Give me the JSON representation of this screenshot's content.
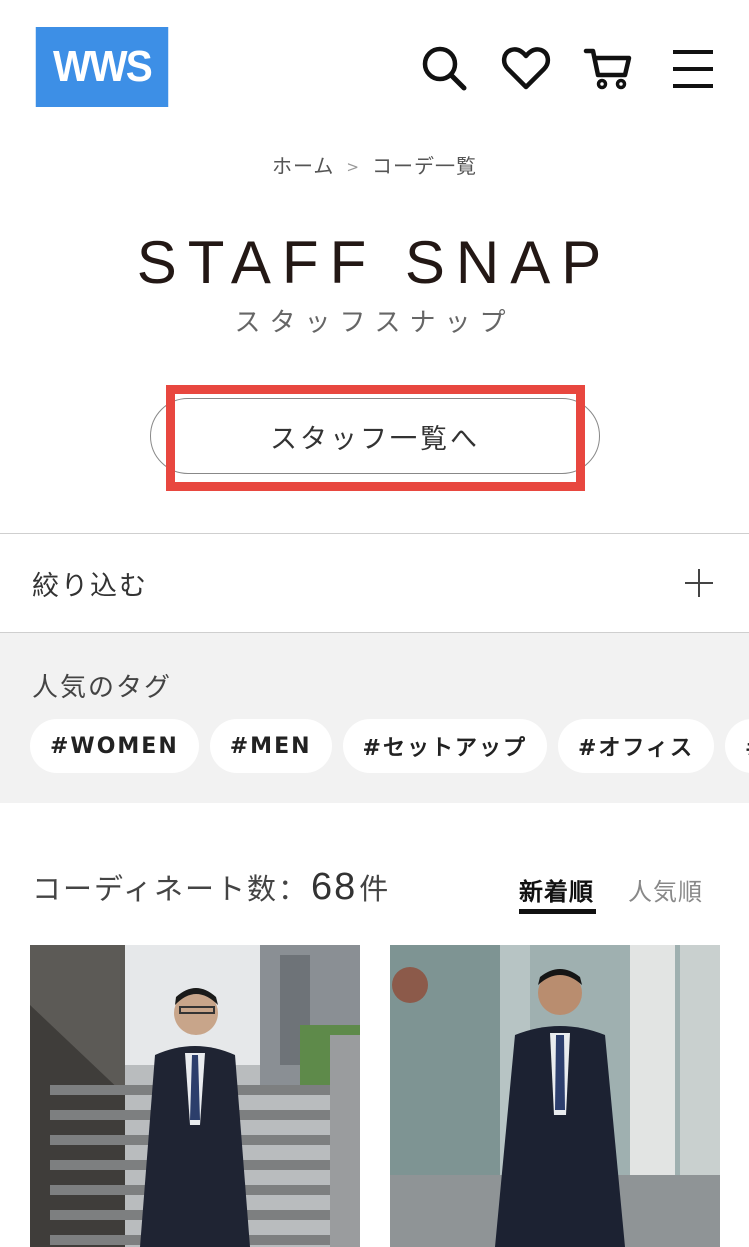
{
  "header": {
    "logo": "WWS",
    "icons": [
      "search-icon",
      "heart-icon",
      "cart-icon",
      "menu-icon"
    ]
  },
  "breadcrumb": {
    "home": "ホーム",
    "separator": ">",
    "current": "コーデ一覧"
  },
  "title": "STAFF SNAP",
  "subtitle": "スタッフスナップ",
  "staff_button": "スタッフ一覧へ",
  "filter": {
    "label": "絞り込む"
  },
  "tags": {
    "title": "人気のタグ",
    "items": [
      "#WOMEN",
      "#MEN",
      "#セットアップ",
      "#オフィス",
      "#ダーク"
    ]
  },
  "count": {
    "prefix": "コーディネート数：",
    "value": "68",
    "suffix": "件"
  },
  "sort": {
    "newest": "新着順",
    "popular": "人気順"
  },
  "colors": {
    "brand": "#3d8fe6",
    "highlight": "#e8473f",
    "tag_bg": "#f2f2f2"
  }
}
